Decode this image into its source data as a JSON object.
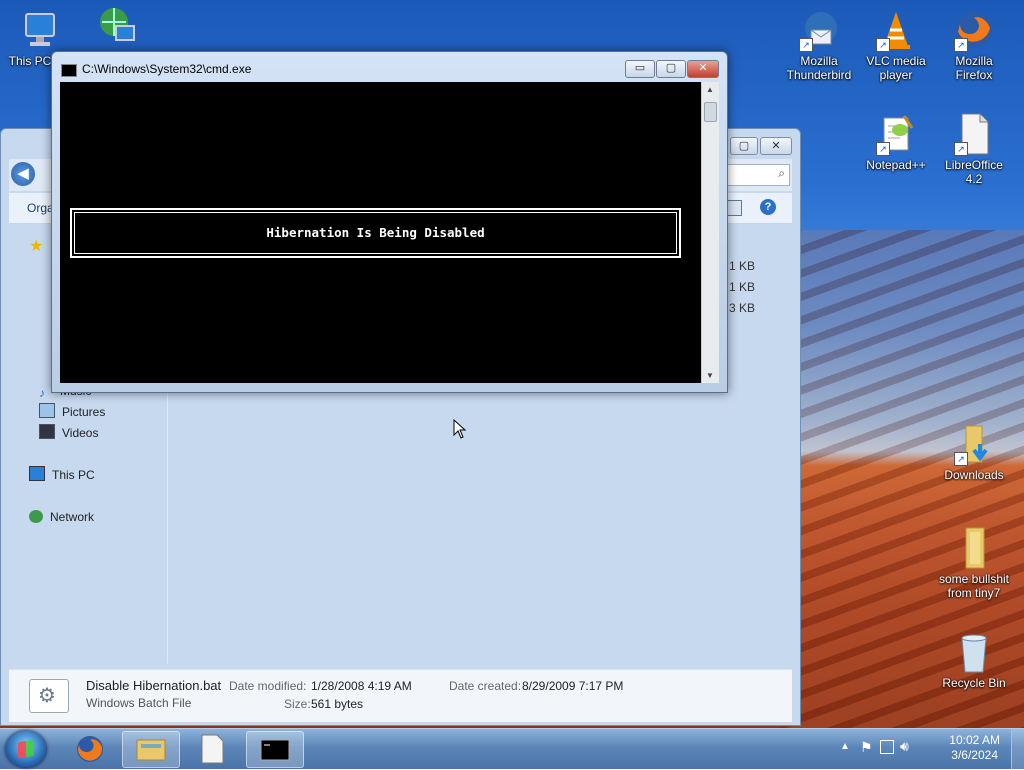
{
  "desktop": {
    "icons_left": [
      {
        "label": "This PC",
        "icon": "computer-icon"
      },
      {
        "label": "",
        "icon": "network-globe-icon"
      }
    ],
    "icons_right": [
      {
        "label": "Mozilla Thunderbird",
        "icon": "thunderbird-icon"
      },
      {
        "label": "VLC media player",
        "icon": "vlc-cone-icon"
      },
      {
        "label": "Mozilla Firefox",
        "icon": "firefox-icon"
      },
      {
        "label": "Notepad++",
        "icon": "notepadpp-icon"
      },
      {
        "label": "LibreOffice 4.2",
        "icon": "libreoffice-doc-icon"
      },
      {
        "label": "Downloads",
        "icon": "downloads-folder-icon"
      },
      {
        "label": "some bullshit from tiny7",
        "icon": "folder-icon"
      },
      {
        "label": "Recycle Bin",
        "icon": "recycle-bin-icon"
      }
    ]
  },
  "cmd": {
    "title": "C:\\Windows\\System32\\cmd.exe",
    "banner": "Hibernation Is Being Disabled",
    "buttons": {
      "minimize": "▭",
      "maximize": "▢",
      "close": "✕"
    }
  },
  "explorer": {
    "organize": "Orga",
    "nav": [
      {
        "label": "Music",
        "icon": "music-icon"
      },
      {
        "label": "Pictures",
        "icon": "pictures-icon"
      },
      {
        "label": "Videos",
        "icon": "videos-icon"
      },
      {
        "label": "This PC",
        "icon": "computer-icon"
      },
      {
        "label": "Network",
        "icon": "network-icon"
      }
    ],
    "sizes": [
      "1 KB",
      "1 KB",
      "3 KB"
    ],
    "details": {
      "file_name": "Disable Hibernation.bat",
      "file_type": "Windows Batch File",
      "date_modified_label": "Date modified:",
      "date_modified": "1/28/2008 4:19 AM",
      "date_created_label": "Date created:",
      "date_created": "8/29/2009 7:17 PM",
      "size_label": "Size:",
      "size": "561 bytes"
    }
  },
  "taskbar": {
    "time": "10:02 AM",
    "date": "3/6/2024",
    "pinned": [
      {
        "name": "firefox-taskbar-icon"
      },
      {
        "name": "explorer-taskbar-icon"
      },
      {
        "name": "document-taskbar-icon"
      },
      {
        "name": "cmd-taskbar-icon",
        "active": true
      }
    ]
  },
  "colors": {
    "accent": "#2c6fc9",
    "console_bg": "#000000",
    "console_fg": "#ffffff"
  }
}
